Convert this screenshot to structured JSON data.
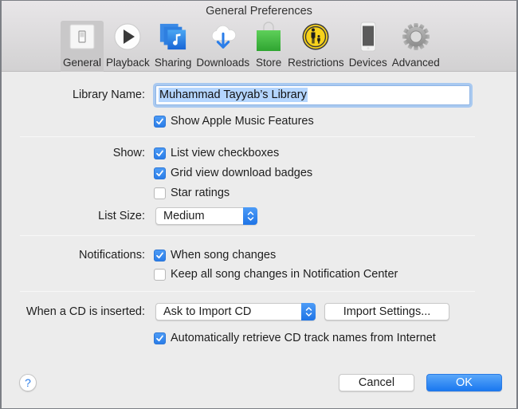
{
  "window": {
    "title": "General Preferences"
  },
  "toolbar": {
    "items": [
      {
        "label": "General",
        "icon": "general-switch-icon",
        "selected": true
      },
      {
        "label": "Playback",
        "icon": "play-icon",
        "selected": false
      },
      {
        "label": "Sharing",
        "icon": "sharing-music-icon",
        "selected": false
      },
      {
        "label": "Downloads",
        "icon": "cloud-download-icon",
        "selected": false
      },
      {
        "label": "Store",
        "icon": "shopping-bag-icon",
        "selected": false
      },
      {
        "label": "Restrictions",
        "icon": "parental-restrictions-icon",
        "selected": false
      },
      {
        "label": "Devices",
        "icon": "iphone-device-icon",
        "selected": false
      },
      {
        "label": "Advanced",
        "icon": "gear-icon",
        "selected": false
      }
    ]
  },
  "library": {
    "label": "Library Name:",
    "value": "Muhammad Tayyab’s Library",
    "show_apple_music": {
      "label": "Show Apple Music Features",
      "checked": true
    }
  },
  "show": {
    "label": "Show:",
    "options": [
      {
        "label": "List view checkboxes",
        "checked": true
      },
      {
        "label": "Grid view download badges",
        "checked": true
      },
      {
        "label": "Star ratings",
        "checked": false
      }
    ],
    "list_size": {
      "label": "List Size:",
      "value": "Medium"
    }
  },
  "notifications": {
    "label": "Notifications:",
    "options": [
      {
        "label": "When song changes",
        "checked": true
      },
      {
        "label": "Keep all song changes in Notification Center",
        "checked": false
      }
    ]
  },
  "cd": {
    "label": "When a CD is inserted:",
    "action": "Ask to Import CD",
    "import_settings_label": "Import Settings...",
    "auto_retrieve": {
      "label": "Automatically retrieve CD track names from Internet",
      "checked": true
    }
  },
  "footer": {
    "help_label": "?",
    "cancel_label": "Cancel",
    "ok_label": "OK"
  },
  "colors": {
    "accent": "#2a7de9",
    "selection": "#b4d5fe"
  }
}
